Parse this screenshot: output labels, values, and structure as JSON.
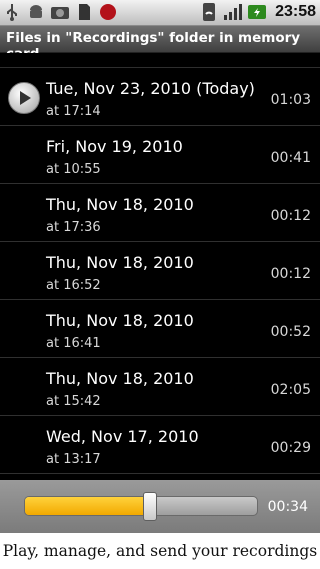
{
  "status_bar": {
    "icons": [
      "usb-icon",
      "android-icon",
      "camera-icon",
      "sd-card-icon",
      "record-icon"
    ],
    "right_icons": [
      "wifi-icon",
      "signal-icon",
      "battery-icon"
    ],
    "time": "23:58"
  },
  "title": "Files in \"Recordings\" folder in memory card",
  "recordings": [
    {
      "date": "Tue, Nov 23, 2010 (Today)",
      "time": "at 17:14",
      "duration": "01:03",
      "playing": true
    },
    {
      "date": "Fri, Nov 19, 2010",
      "time": "at 10:55",
      "duration": "00:41"
    },
    {
      "date": "Thu, Nov 18, 2010",
      "time": "at 17:36",
      "duration": "00:12"
    },
    {
      "date": "Thu, Nov 18, 2010",
      "time": "at 16:52",
      "duration": "00:12"
    },
    {
      "date": "Thu, Nov 18, 2010",
      "time": "at 16:41",
      "duration": "00:52"
    },
    {
      "date": "Thu, Nov 18, 2010",
      "time": "at 15:42",
      "duration": "02:05"
    },
    {
      "date": "Wed, Nov 17, 2010",
      "time": "at 13:17",
      "duration": "00:29"
    }
  ],
  "player": {
    "position_text": "00:34",
    "progress": 0.54,
    "accent": "#f5b400"
  },
  "caption": "Play, manage, and send your recordings"
}
